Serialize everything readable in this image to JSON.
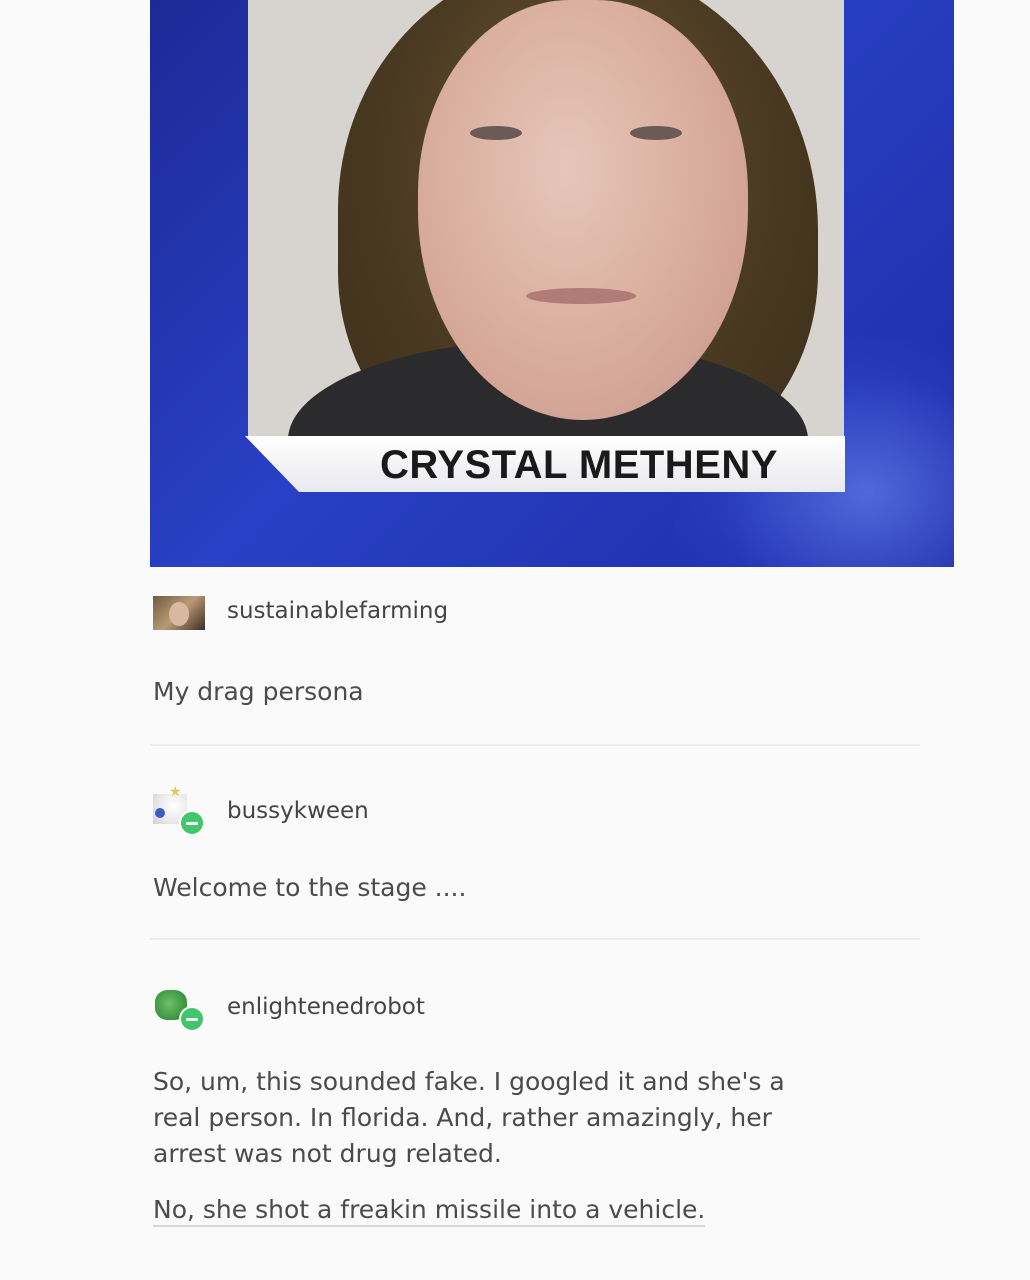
{
  "news_graphic": {
    "caption": "CRYSTAL METHENY",
    "background_color": "#2940c6"
  },
  "thread": [
    {
      "username": "sustainablefarming",
      "paragraphs": [
        "My drag persona"
      ]
    },
    {
      "username": "bussykween",
      "paragraphs": [
        "Welcome to the stage ...."
      ]
    },
    {
      "username": "enlightenedrobot",
      "paragraphs": [
        "So, um, this sounded fake. I googled it and she's a real person. In florida. And, rather amazingly, her arrest was not drug related.",
        "No, she shot a freakin missile into a vehicle."
      ]
    }
  ],
  "icons": {
    "follow_badge": "minus-badge-icon"
  }
}
